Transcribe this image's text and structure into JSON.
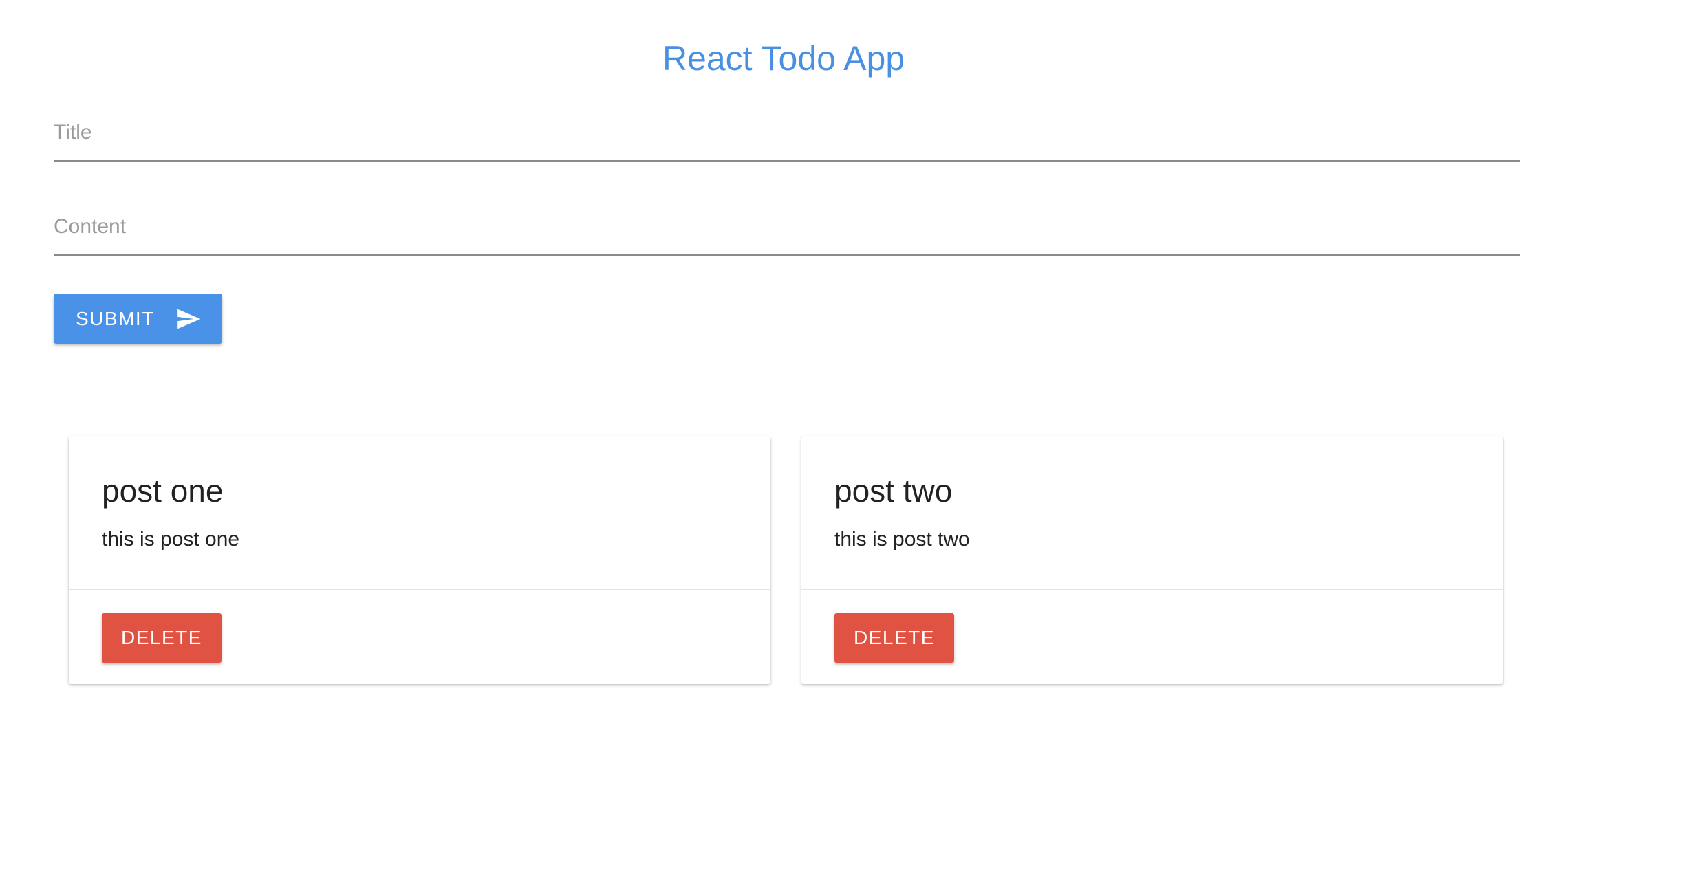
{
  "header": {
    "title": "React Todo App"
  },
  "form": {
    "title_field": {
      "value": "",
      "placeholder": "Title"
    },
    "content_field": {
      "value": "",
      "placeholder": "Content"
    },
    "submit_label": "SUBMIT",
    "submit_icon": "send-icon"
  },
  "posts": [
    {
      "title": "post one",
      "content": "this is post one",
      "delete_label": "DELETE"
    },
    {
      "title": "post two",
      "content": "this is post two",
      "delete_label": "DELETE"
    }
  ],
  "colors": {
    "title": "#4a90e2",
    "submit": "#4a92e8",
    "delete": "#e05343",
    "underline": "#8a8a8a"
  }
}
